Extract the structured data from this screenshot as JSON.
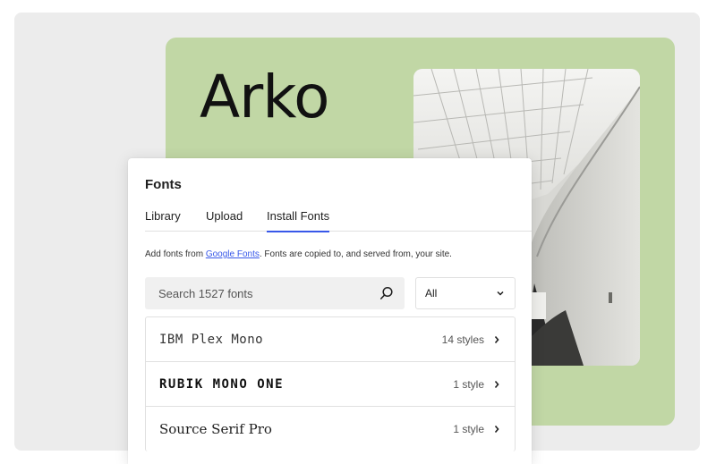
{
  "hero": {
    "title": "Arko"
  },
  "panel": {
    "title": "Fonts",
    "tabs": [
      {
        "label": "Library"
      },
      {
        "label": "Upload"
      },
      {
        "label": "Install Fonts",
        "active": true
      }
    ],
    "help": {
      "prefix": "Add fonts from ",
      "link": "Google Fonts",
      "suffix": ". Fonts are copied to, and served from, your site."
    },
    "search": {
      "placeholder": "Search 1527 fonts",
      "icon": "search-icon"
    },
    "filter": {
      "selected": "All",
      "icon": "chevron-down-icon"
    },
    "fonts": [
      {
        "name": "IBM Plex Mono",
        "styles": "14 styles"
      },
      {
        "name": "RUBIK MONO ONE",
        "styles": "1 style"
      },
      {
        "name": "Source Serif Pro",
        "styles": "1 style"
      }
    ]
  },
  "colors": {
    "frame": "#ececec",
    "card": "#c1d7a5",
    "accent": "#3858e9"
  }
}
